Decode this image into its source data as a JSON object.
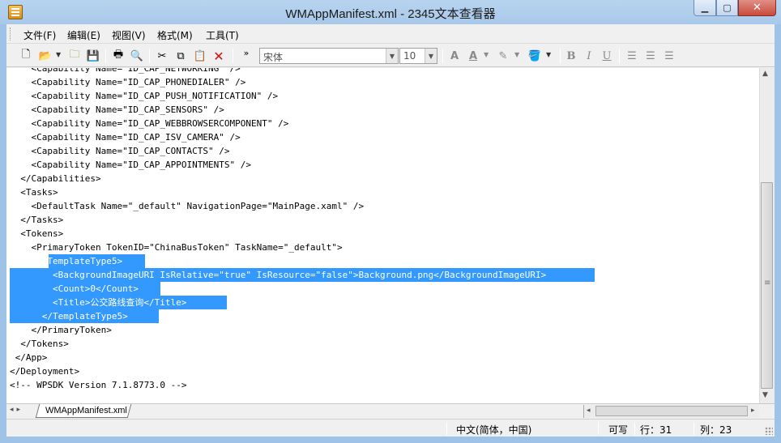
{
  "window": {
    "title": "WMAppManifest.xml - 2345文本查看器"
  },
  "menu": [
    {
      "label": "文件(F)"
    },
    {
      "label": "编辑(E)"
    },
    {
      "label": "视图(V)"
    },
    {
      "label": "格式(M)"
    },
    {
      "label": "工具(T)"
    }
  ],
  "toolbar": {
    "icons": [
      "new-file-icon",
      "open-folder-icon",
      "open-dropdown-icon",
      "open-recent-folder-icon",
      "save-icon",
      "print-icon",
      "find-icon",
      "cut-icon",
      "copy-icon",
      "paste-icon",
      "delete-icon",
      "overflow-icon"
    ],
    "font_name": "宋体",
    "font_size": "10",
    "format_icons": [
      "font-grow-icon",
      "font-color-icon",
      "highlight-icon",
      "fill-color-icon",
      "bold-icon",
      "italic-icon",
      "underline-icon",
      "align-left-icon",
      "align-center-icon",
      "align-right-icon"
    ]
  },
  "editor": {
    "lines": [
      "    <Capability Name=\"ID_CAP_NETWORKING\" />",
      "    <Capability Name=\"ID_CAP_PHONEDIALER\" />",
      "    <Capability Name=\"ID_CAP_PUSH_NOTIFICATION\" />",
      "    <Capability Name=\"ID_CAP_SENSORS\" />",
      "    <Capability Name=\"ID_CAP_WEBBROWSERCOMPONENT\" />",
      "    <Capability Name=\"ID_CAP_ISV_CAMERA\" />",
      "    <Capability Name=\"ID_CAP_CONTACTS\" />",
      "    <Capability Name=\"ID_CAP_APPOINTMENTS\" />",
      "  </Capabilities>",
      "  <Tasks>",
      "    <DefaultTask Name=\"_default\" NavigationPage=\"MainPage.xaml\" />",
      "  </Tasks>",
      "  <Tokens>",
      "    <PrimaryToken TokenID=\"ChinaBusToken\" TaskName=\"_default\">",
      "      <TemplateType5>",
      "        <BackgroundImageURI IsRelative=\"true\" IsResource=\"false\">Background.png</BackgroundImageURI>",
      "        <Count>0</Count>",
      "        <Title>公交路线查询</Title>",
      "      </TemplateType5>",
      "    </PrimaryToken>",
      "  </Tokens>",
      " </App>",
      "</Deployment>",
      "<!-- WPSDK Version 7.1.8773.0 -->"
    ],
    "selected_line_range": [
      14,
      18
    ]
  },
  "tabs": [
    {
      "label": "WMAppManifest.xml",
      "active": true
    }
  ],
  "status": {
    "encoding": "中文(简体，中国)",
    "mode": "可写",
    "row": "行：31",
    "col": "列：23"
  },
  "colors": {
    "selection": "#3399ff",
    "selection_text": "#ffffff",
    "titlebar": "#a9c9ea"
  }
}
